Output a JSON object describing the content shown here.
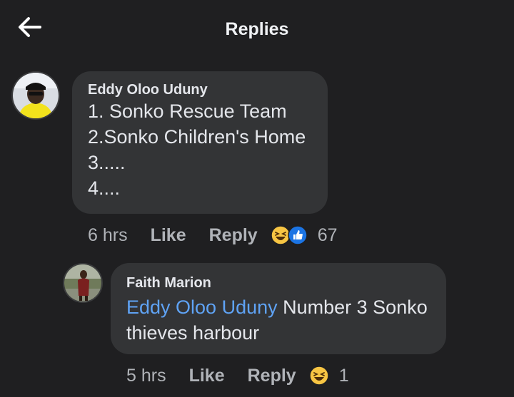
{
  "header": {
    "title": "Replies",
    "back_icon": "arrow-left-icon"
  },
  "comments": [
    {
      "author": "Eddy Oloo Uduny",
      "lines": [
        "1. Sonko Rescue Team",
        "2.Sonko Children's Home",
        "3.....",
        "4...."
      ],
      "time": "6 hrs",
      "like_label": "Like",
      "reply_label": "Reply",
      "reactions": [
        "haha-icon",
        "like-icon"
      ],
      "reaction_count": "67"
    },
    {
      "author": "Faith Marion",
      "mention": "Eddy Oloo Uduny",
      "text": " Number 3 Sonko thieves harbour",
      "time": "5 hrs",
      "like_label": "Like",
      "reply_label": "Reply",
      "reactions": [
        "haha-icon"
      ],
      "reaction_count": "1"
    }
  ],
  "colors": {
    "background": "#1f1f21",
    "bubble": "#333436",
    "mention": "#5fa3f5",
    "muted": "#b0b3b8"
  }
}
